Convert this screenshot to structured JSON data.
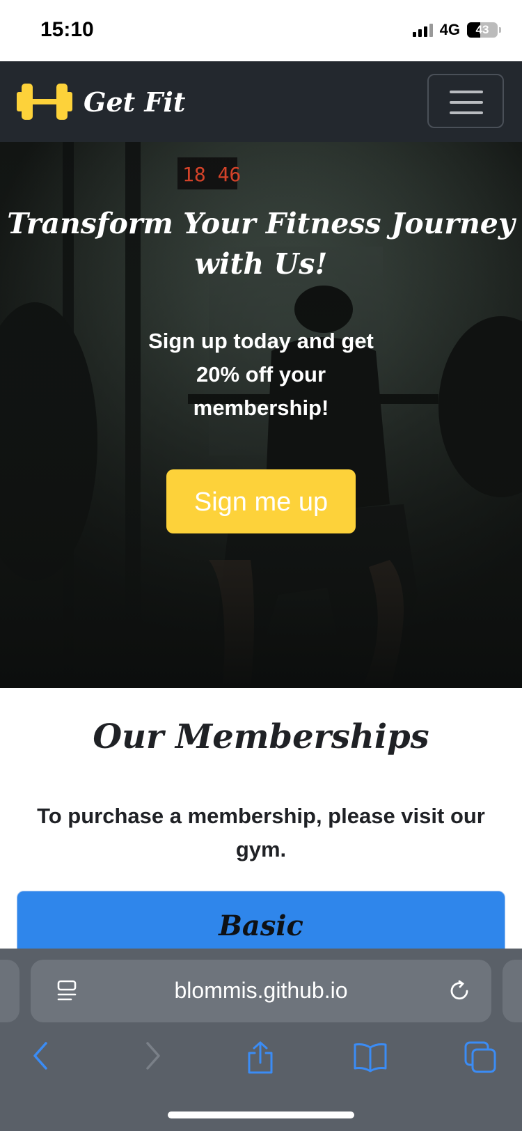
{
  "status": {
    "time": "15:10",
    "network": "4G",
    "battery": "43",
    "battery_level": 0.43
  },
  "navbar": {
    "brand": "Get Fit",
    "logo_icon": "dumbbell-icon",
    "menu_icon": "hamburger-icon"
  },
  "hero": {
    "title": "Transform Your Fitness Journey with Us!",
    "subtitle": "Sign up today and get 20% off your membership!",
    "cta_label": "Sign me up"
  },
  "memberships": {
    "title": "Our Memberships",
    "text": "To purchase a membership, please visit our gym.",
    "cards": [
      {
        "title": "Basic"
      }
    ]
  },
  "browser": {
    "url": "blommis.github.io",
    "icons": [
      "reader-icon",
      "reload-icon",
      "back-icon",
      "forward-icon",
      "share-icon",
      "bookmarks-icon",
      "tabs-icon"
    ]
  },
  "colors": {
    "navbar": "#23282e",
    "accent_yellow": "#fdd23a",
    "card_blue": "#2f86eb",
    "browser_link_blue": "#3b8cf5"
  }
}
